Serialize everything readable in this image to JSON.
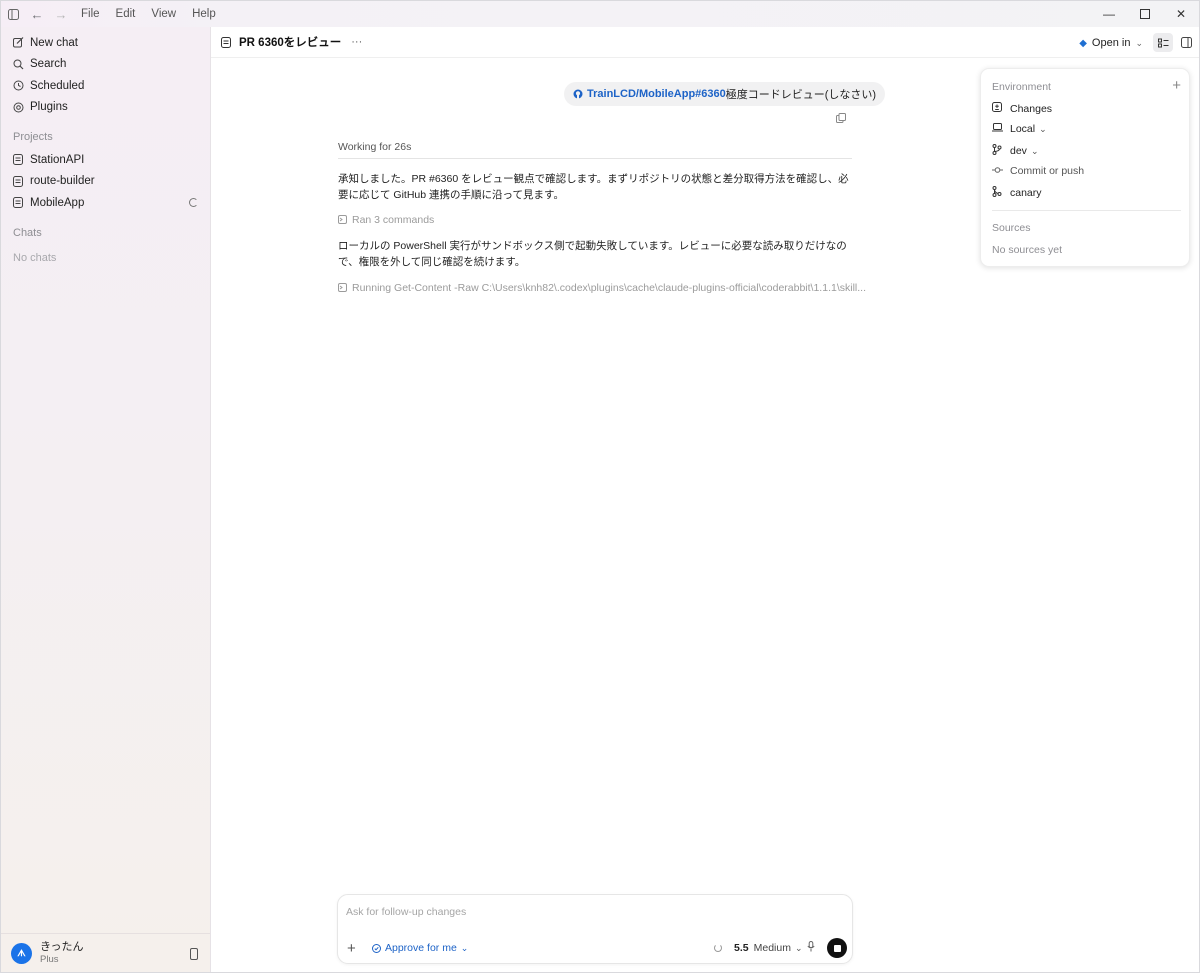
{
  "menu": [
    "File",
    "Edit",
    "View",
    "Help"
  ],
  "sidebar": {
    "nav": [
      {
        "label": "New chat",
        "icon": "edit-icon"
      },
      {
        "label": "Search",
        "icon": "search-icon"
      },
      {
        "label": "Scheduled",
        "icon": "clock-icon"
      },
      {
        "label": "Plugins",
        "icon": "plugin-icon"
      }
    ],
    "projects_label": "Projects",
    "projects": [
      "StationAPI",
      "route-builder",
      "MobileApp"
    ],
    "chats_label": "Chats",
    "chats_empty": "No chats",
    "user": {
      "name": "きったん",
      "plan": "Plus",
      "avatar_color": "#1a73e8"
    }
  },
  "header": {
    "title": "PR 6360をレビュー",
    "more": "···",
    "open_in": "Open in"
  },
  "conversation": {
    "user_msg": {
      "link": "TrainLCD/MobileApp#6360",
      "text": " 極度コードレビュー(しなさい)"
    },
    "working": "Working for 26s",
    "para1": "承知しました。PR #6360 をレビュー観点で確認します。まずリポジトリの状態と差分取得方法を確認し、必要に応じて GitHub 連携の手順に沿って見ます。",
    "ran_commands": "Ran 3 commands",
    "para2": "ローカルの PowerShell 実行がサンドボックス側で起動失敗しています。レビューに必要な読み取りだけなので、権限を外して同じ確認を続けます。",
    "running": "Running Get-Content -Raw C:\\Users\\knh82\\.codex\\plugins\\cache\\claude-plugins-official\\coderabbit\\1.1.1\\skill..."
  },
  "environment": {
    "label": "Environment",
    "items": [
      {
        "label": "Changes",
        "icon": "diff-icon"
      },
      {
        "label": "Local",
        "icon": "laptop-icon",
        "dropdown": true
      },
      {
        "label": "dev",
        "icon": "branch-icon",
        "dropdown": true
      },
      {
        "label": "Commit or push",
        "icon": "commit-icon"
      },
      {
        "label": "canary",
        "icon": "merge-icon"
      }
    ],
    "sources_label": "Sources",
    "sources_empty": "No sources yet"
  },
  "composer": {
    "placeholder": "Ask for follow-up changes",
    "approve": "Approve for me",
    "model": "5.5",
    "effort": "Medium"
  },
  "colors": {
    "accent": "#1a73e8",
    "link": "#1d63c7"
  }
}
